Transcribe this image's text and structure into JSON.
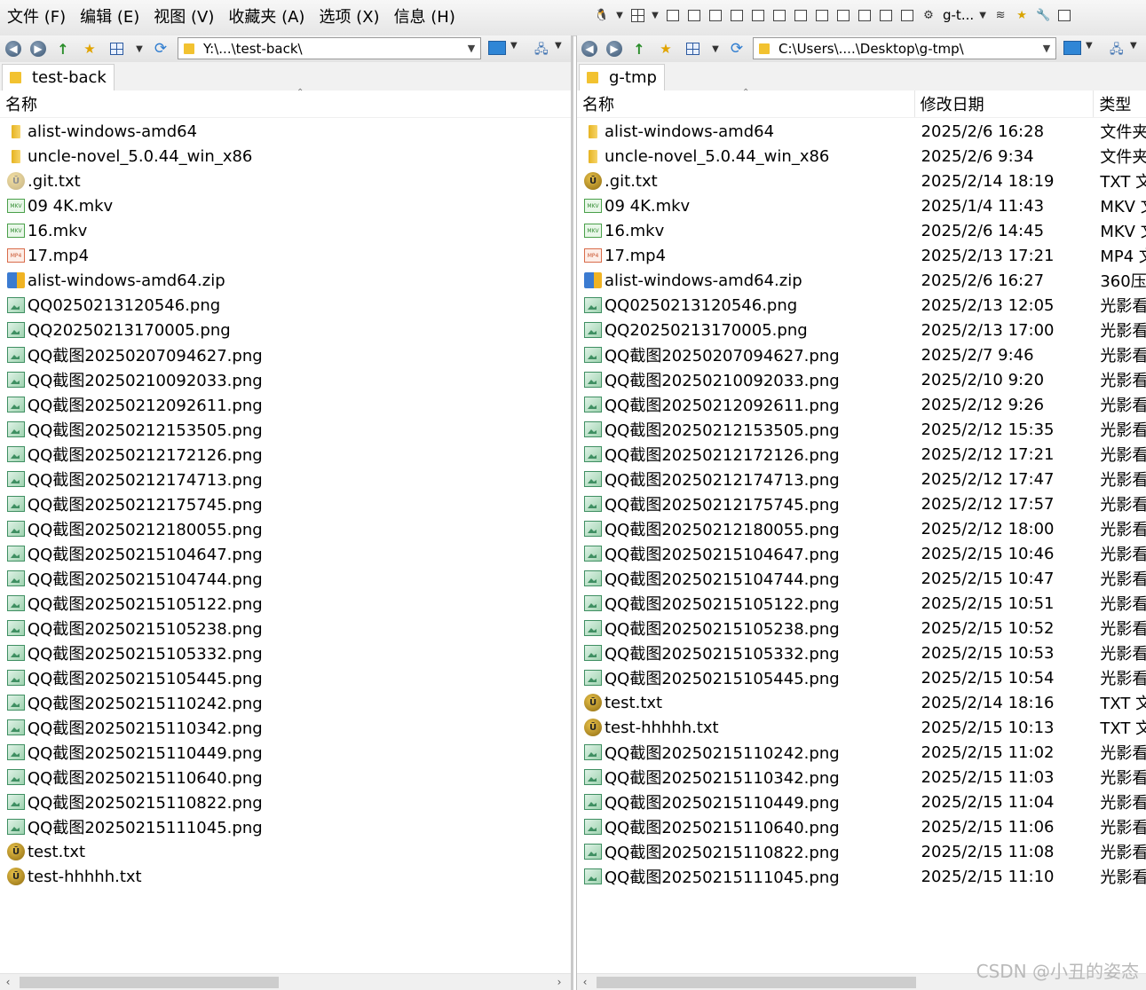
{
  "menu": [
    "文件 (F)",
    "编辑 (E)",
    "视图 (V)",
    "收藏夹 (A)",
    "选项 (X)",
    "信息 (H)"
  ],
  "toolbar": {
    "sync_label": "g-t..."
  },
  "left_pane": {
    "address": "Y:\\...\\test-back\\",
    "tab": "test-back",
    "columns": {
      "name": "名称"
    },
    "files": [
      {
        "name": "alist-windows-amd64",
        "icon": "folder-icon"
      },
      {
        "name": "uncle-novel_5.0.44_win_x86",
        "icon": "folder-icon"
      },
      {
        "name": ".git.txt",
        "icon": "txt-icon"
      },
      {
        "name": "09 4K.mkv",
        "icon": "mkv-icon"
      },
      {
        "name": "16.mkv",
        "icon": "mkv-icon"
      },
      {
        "name": "17.mp4",
        "icon": "mp4-icon"
      },
      {
        "name": "alist-windows-amd64.zip",
        "icon": "zip-icon"
      },
      {
        "name": "QQ0250213120546.png",
        "icon": "png-icon"
      },
      {
        "name": "QQ20250213170005.png",
        "icon": "png-icon"
      },
      {
        "name": "QQ截图20250207094627.png",
        "icon": "png-icon"
      },
      {
        "name": "QQ截图20250210092033.png",
        "icon": "png-icon"
      },
      {
        "name": "QQ截图20250212092611.png",
        "icon": "png-icon"
      },
      {
        "name": "QQ截图20250212153505.png",
        "icon": "png-icon"
      },
      {
        "name": "QQ截图20250212172126.png",
        "icon": "png-icon"
      },
      {
        "name": "QQ截图20250212174713.png",
        "icon": "png-icon"
      },
      {
        "name": "QQ截图20250212175745.png",
        "icon": "png-icon"
      },
      {
        "name": "QQ截图20250212180055.png",
        "icon": "png-icon"
      },
      {
        "name": "QQ截图20250215104647.png",
        "icon": "png-icon"
      },
      {
        "name": "QQ截图20250215104744.png",
        "icon": "png-icon"
      },
      {
        "name": "QQ截图20250215105122.png",
        "icon": "png-icon"
      },
      {
        "name": "QQ截图20250215105238.png",
        "icon": "png-icon"
      },
      {
        "name": "QQ截图20250215105332.png",
        "icon": "png-icon"
      },
      {
        "name": "QQ截图20250215105445.png",
        "icon": "png-icon"
      },
      {
        "name": "QQ截图20250215110242.png",
        "icon": "png-icon"
      },
      {
        "name": "QQ截图20250215110342.png",
        "icon": "png-icon"
      },
      {
        "name": "QQ截图20250215110449.png",
        "icon": "png-icon"
      },
      {
        "name": "QQ截图20250215110640.png",
        "icon": "png-icon"
      },
      {
        "name": "QQ截图20250215110822.png",
        "icon": "png-icon"
      },
      {
        "name": "QQ截图20250215111045.png",
        "icon": "png-icon"
      },
      {
        "name": "test.txt",
        "icon": "txt-icon"
      },
      {
        "name": "test-hhhhh.txt",
        "icon": "txt-icon"
      }
    ]
  },
  "right_pane": {
    "address": "C:\\Users\\....\\Desktop\\g-tmp\\",
    "tab": "g-tmp",
    "columns": {
      "name": "名称",
      "modified": "修改日期",
      "type": "类型"
    },
    "files": [
      {
        "name": "alist-windows-amd64",
        "icon": "folder-icon",
        "modified": "2025/2/6 16:28",
        "type": "文件夹"
      },
      {
        "name": "uncle-novel_5.0.44_win_x86",
        "icon": "folder-icon",
        "modified": "2025/2/6 9:34",
        "type": "文件夹"
      },
      {
        "name": ".git.txt",
        "icon": "txt-icon",
        "modified": "2025/2/14 18:19",
        "type": "TXT 文"
      },
      {
        "name": "09 4K.mkv",
        "icon": "mkv-icon",
        "modified": "2025/1/4 11:43",
        "type": "MKV 文"
      },
      {
        "name": "16.mkv",
        "icon": "mkv-icon",
        "modified": "2025/2/6 14:45",
        "type": "MKV 文"
      },
      {
        "name": "17.mp4",
        "icon": "mp4-icon",
        "modified": "2025/2/13 17:21",
        "type": "MP4 文"
      },
      {
        "name": "alist-windows-amd64.zip",
        "icon": "zip-icon",
        "modified": "2025/2/6 16:27",
        "type": "360压"
      },
      {
        "name": "QQ0250213120546.png",
        "icon": "png-icon",
        "modified": "2025/2/13 12:05",
        "type": "光影看"
      },
      {
        "name": "QQ20250213170005.png",
        "icon": "png-icon",
        "modified": "2025/2/13 17:00",
        "type": "光影看"
      },
      {
        "name": "QQ截图20250207094627.png",
        "icon": "png-icon",
        "modified": "2025/2/7 9:46",
        "type": "光影看"
      },
      {
        "name": "QQ截图20250210092033.png",
        "icon": "png-icon",
        "modified": "2025/2/10 9:20",
        "type": "光影看"
      },
      {
        "name": "QQ截图20250212092611.png",
        "icon": "png-icon",
        "modified": "2025/2/12 9:26",
        "type": "光影看"
      },
      {
        "name": "QQ截图20250212153505.png",
        "icon": "png-icon",
        "modified": "2025/2/12 15:35",
        "type": "光影看"
      },
      {
        "name": "QQ截图20250212172126.png",
        "icon": "png-icon",
        "modified": "2025/2/12 17:21",
        "type": "光影看"
      },
      {
        "name": "QQ截图20250212174713.png",
        "icon": "png-icon",
        "modified": "2025/2/12 17:47",
        "type": "光影看"
      },
      {
        "name": "QQ截图20250212175745.png",
        "icon": "png-icon",
        "modified": "2025/2/12 17:57",
        "type": "光影看"
      },
      {
        "name": "QQ截图20250212180055.png",
        "icon": "png-icon",
        "modified": "2025/2/12 18:00",
        "type": "光影看"
      },
      {
        "name": "QQ截图20250215104647.png",
        "icon": "png-icon",
        "modified": "2025/2/15 10:46",
        "type": "光影看"
      },
      {
        "name": "QQ截图20250215104744.png",
        "icon": "png-icon",
        "modified": "2025/2/15 10:47",
        "type": "光影看"
      },
      {
        "name": "QQ截图20250215105122.png",
        "icon": "png-icon",
        "modified": "2025/2/15 10:51",
        "type": "光影看"
      },
      {
        "name": "QQ截图20250215105238.png",
        "icon": "png-icon",
        "modified": "2025/2/15 10:52",
        "type": "光影看"
      },
      {
        "name": "QQ截图20250215105332.png",
        "icon": "png-icon",
        "modified": "2025/2/15 10:53",
        "type": "光影看"
      },
      {
        "name": "QQ截图20250215105445.png",
        "icon": "png-icon",
        "modified": "2025/2/15 10:54",
        "type": "光影看"
      },
      {
        "name": "test.txt",
        "icon": "txt-icon",
        "modified": "2025/2/14 18:16",
        "type": "TXT 文"
      },
      {
        "name": "test-hhhhh.txt",
        "icon": "txt-icon",
        "modified": "2025/2/15 10:13",
        "type": "TXT 文"
      },
      {
        "name": "QQ截图20250215110242.png",
        "icon": "png-icon",
        "modified": "2025/2/15 11:02",
        "type": "光影看"
      },
      {
        "name": "QQ截图20250215110342.png",
        "icon": "png-icon",
        "modified": "2025/2/15 11:03",
        "type": "光影看"
      },
      {
        "name": "QQ截图20250215110449.png",
        "icon": "png-icon",
        "modified": "2025/2/15 11:04",
        "type": "光影看"
      },
      {
        "name": "QQ截图20250215110640.png",
        "icon": "png-icon",
        "modified": "2025/2/15 11:06",
        "type": "光影看"
      },
      {
        "name": "QQ截图20250215110822.png",
        "icon": "png-icon",
        "modified": "2025/2/15 11:08",
        "type": "光影看"
      },
      {
        "name": "QQ截图20250215111045.png",
        "icon": "png-icon",
        "modified": "2025/2/15 11:10",
        "type": "光影看"
      }
    ]
  },
  "watermark": "CSDN @小丑的姿态"
}
